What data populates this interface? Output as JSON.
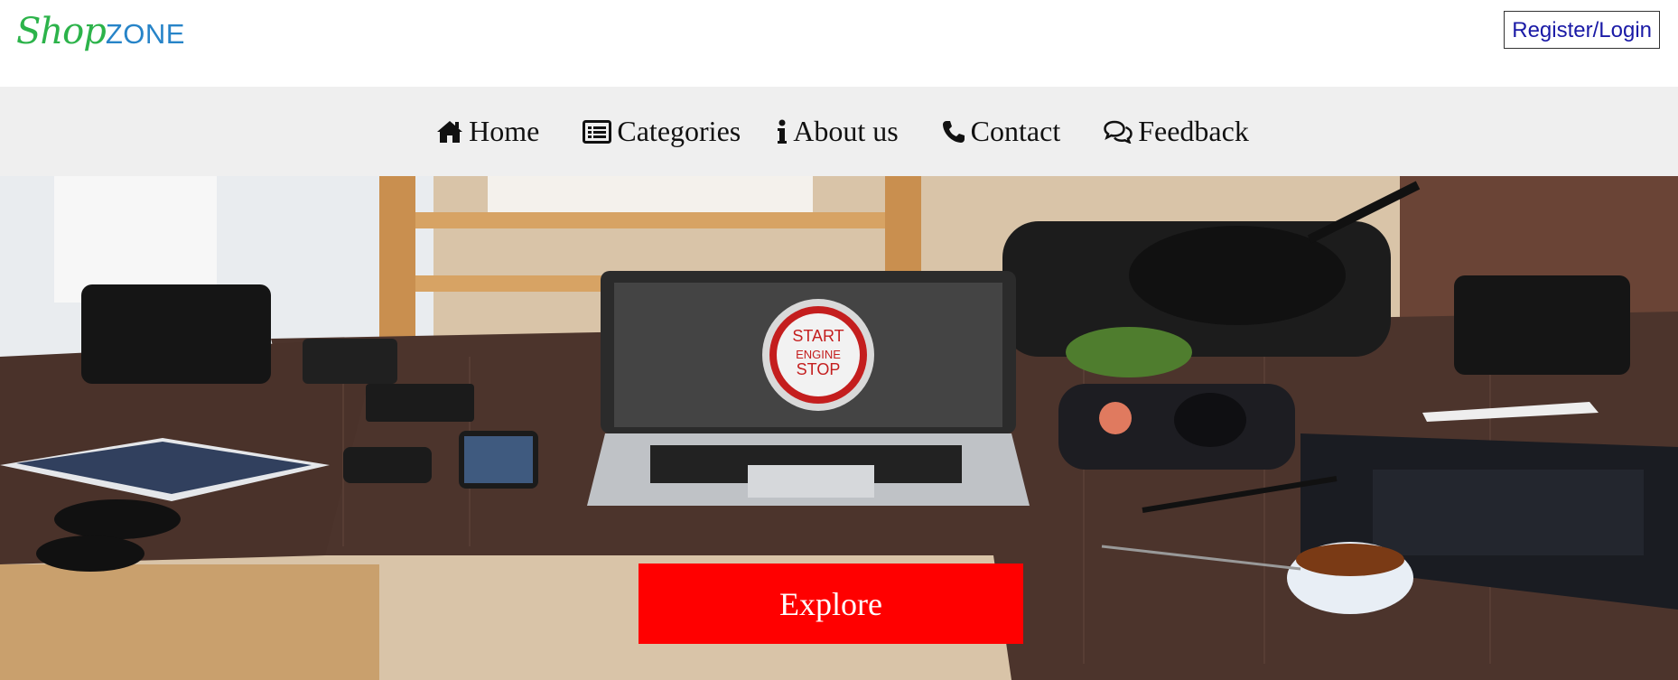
{
  "header": {
    "logo_part1": "Shop",
    "logo_part2": "ZONE",
    "register_label": "Register/Login"
  },
  "nav": {
    "items": [
      {
        "label": "Home",
        "icon": "home-icon"
      },
      {
        "label": "Categories",
        "icon": "list-icon"
      },
      {
        "label": "About us",
        "icon": "info-icon"
      },
      {
        "label": "Contact",
        "icon": "phone-icon"
      },
      {
        "label": "Feedback",
        "icon": "comments-icon"
      }
    ]
  },
  "hero": {
    "image": "desk-workspace-photo",
    "laptop_screen_text": [
      "START",
      "ENGINE",
      "STOP"
    ],
    "cta_label": "Explore"
  },
  "colors": {
    "logo_green": "#2cb34a",
    "logo_blue": "#2784c8",
    "register_text": "#1a1aa6",
    "nav_bg": "#efefef",
    "cta_bg": "#ff0000"
  }
}
